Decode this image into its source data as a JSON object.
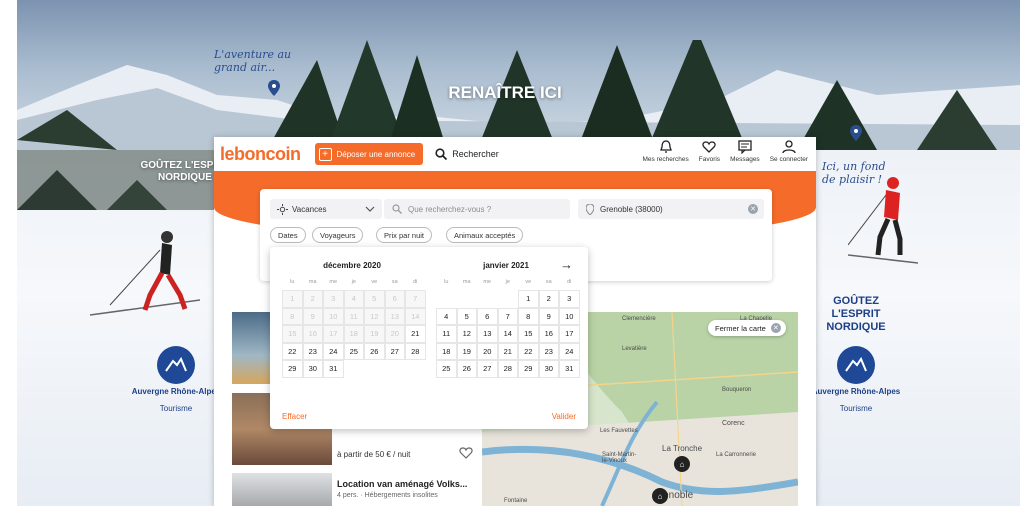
{
  "hero": {
    "slogan": "RENAÎTRE ICI",
    "script_left": "L'aventure au grand air...",
    "script_right": "Ici, un fond de plaisir !",
    "left_panel": {
      "heading": "GOÛTEZ L'ESPRIT NORDIQUE",
      "region_name": "Auvergne Rhône-Alpes",
      "region_sub": "Tourisme"
    },
    "right_panel": {
      "heading": "GOÛTEZ L'ESPRIT NORDIQUE",
      "region_name": "Auvergne Rhône-Alpes",
      "region_sub": "Tourisme"
    }
  },
  "header": {
    "logo": "leboncoin",
    "post_ad": "Déposer une annonce",
    "search": "Rechercher",
    "nav": [
      {
        "label": "Mes recherches",
        "icon": "bell-icon"
      },
      {
        "label": "Favoris",
        "icon": "heart-icon"
      },
      {
        "label": "Messages",
        "icon": "message-icon"
      },
      {
        "label": "Se connecter",
        "icon": "user-icon"
      }
    ]
  },
  "search": {
    "category": "Vacances",
    "query_placeholder": "Que recherchez-vous ?",
    "location": "Grenoble (38000)",
    "filters": [
      "Dates",
      "Voyageurs",
      "Prix par nuit",
      "Animaux acceptés"
    ]
  },
  "calendar": {
    "weekdays": [
      "lu",
      "ma",
      "me",
      "je",
      "ve",
      "sa",
      "di"
    ],
    "months": [
      {
        "title": "décembre 2020",
        "offset": 0,
        "days": 31,
        "past_until": 20
      },
      {
        "title": "janvier 2021",
        "offset": 4,
        "days": 31,
        "past_until": 0
      }
    ],
    "clear": "Effacer",
    "validate": "Valider"
  },
  "listings": [
    {
      "price": "à partir de 50 € / nuit"
    },
    {
      "title": "Location van aménagé Volks...",
      "subtitle": "4 pers. · Hébergements insolites"
    }
  ],
  "map": {
    "close_label": "Fermer la carte",
    "labels": [
      "Clemencière",
      "La Chapelle",
      "Levatière",
      "La Tronche",
      "Saint-Martin-le-Vinoux",
      "Corenc",
      "Bouqueron",
      "Les Fauvettes",
      "Grenoble",
      "La Carronnerie",
      "Fontaine"
    ]
  }
}
